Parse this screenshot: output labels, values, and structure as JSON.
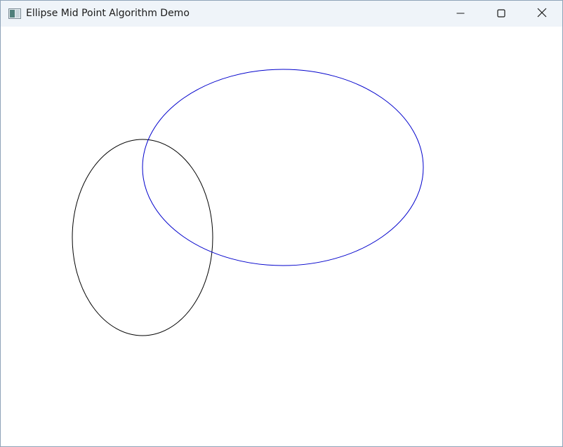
{
  "window": {
    "title": "Ellipse Mid Point Algorithm Demo"
  },
  "titlebar": {
    "app_icon": "app-window-icon",
    "buttons": {
      "minimize": "minimize-icon",
      "maximize": "maximize-icon",
      "close": "close-icon"
    }
  },
  "canvas": {
    "background": "#ffffff",
    "ellipses": [
      {
        "name": "ellipse-black",
        "color": "#000000"
      },
      {
        "name": "ellipse-blue",
        "color": "#0000cc"
      }
    ]
  }
}
